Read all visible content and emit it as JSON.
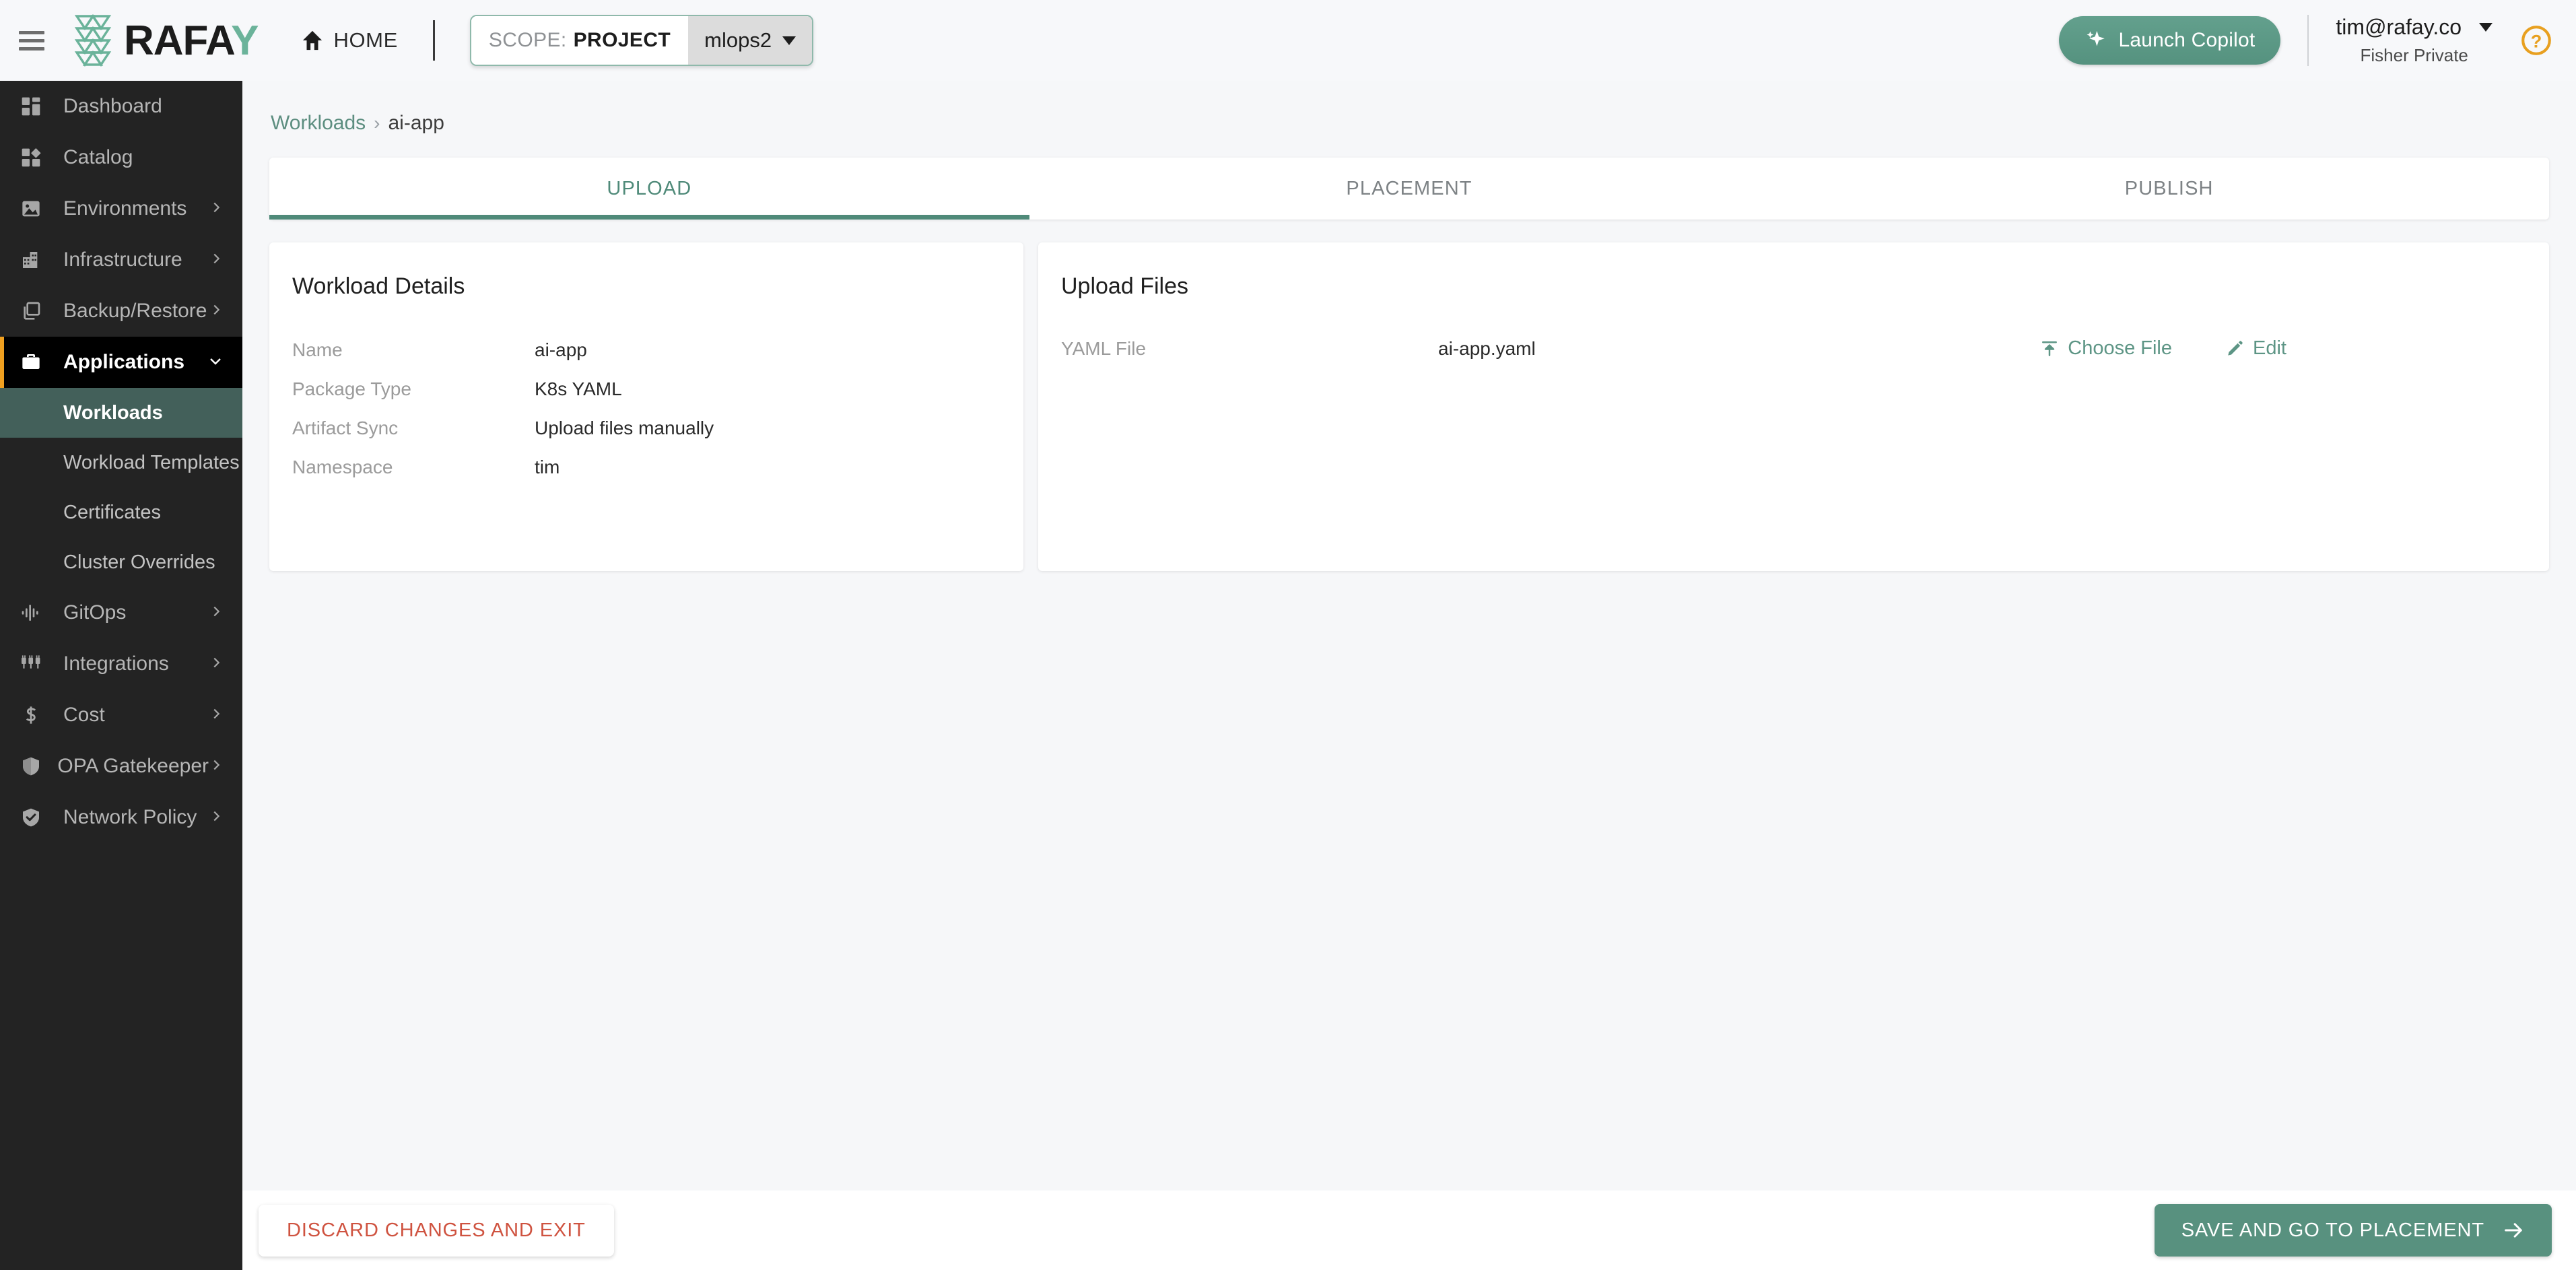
{
  "topbar": {
    "menu_icon": "hamburger-icon",
    "brand": "RAFAY",
    "brand_head": "RAFA",
    "brand_tail": "Y",
    "home_label": "HOME",
    "scope_key": "SCOPE:",
    "scope_value": "PROJECT",
    "project": "mlops2",
    "copilot_label": "Launch Copilot",
    "user_email": "tim@rafay.co",
    "user_org": "Fisher Private",
    "help_icon": "help-circle-icon"
  },
  "sidebar": {
    "items": [
      {
        "label": "Dashboard",
        "icon": "dashboard-icon",
        "expandable": false
      },
      {
        "label": "Catalog",
        "icon": "catalog-icon",
        "expandable": false
      },
      {
        "label": "Environments",
        "icon": "image-icon",
        "expandable": true
      },
      {
        "label": "Infrastructure",
        "icon": "building-icon",
        "expandable": true
      },
      {
        "label": "Backup/Restore",
        "icon": "copy-icon",
        "expandable": true
      },
      {
        "label": "Applications",
        "icon": "briefcase-icon",
        "expandable": true,
        "active": true
      },
      {
        "label": "GitOps",
        "icon": "waveform-icon",
        "expandable": true
      },
      {
        "label": "Integrations",
        "icon": "plugs-icon",
        "expandable": true
      },
      {
        "label": "Cost",
        "icon": "dollar-icon",
        "expandable": true
      },
      {
        "label": "OPA Gatekeeper",
        "icon": "shield-icon",
        "expandable": true
      },
      {
        "label": "Network Policy",
        "icon": "shield-check-icon",
        "expandable": true
      }
    ],
    "sub_items": [
      {
        "label": "Workloads",
        "selected": true
      },
      {
        "label": "Workload Templates",
        "selected": false
      },
      {
        "label": "Certificates",
        "selected": false
      },
      {
        "label": "Cluster Overrides",
        "selected": false
      }
    ]
  },
  "breadcrumb": {
    "root": "Workloads",
    "separator": "›",
    "current": "ai-app"
  },
  "tabs": [
    {
      "label": "UPLOAD",
      "active": true
    },
    {
      "label": "PLACEMENT",
      "active": false
    },
    {
      "label": "PUBLISH",
      "active": false
    }
  ],
  "workload_details": {
    "title": "Workload Details",
    "fields": [
      {
        "label": "Name",
        "value": "ai-app"
      },
      {
        "label": "Package Type",
        "value": "K8s YAML"
      },
      {
        "label": "Artifact Sync",
        "value": "Upload files manually"
      },
      {
        "label": "Namespace",
        "value": "tim"
      }
    ]
  },
  "upload_files": {
    "title": "Upload Files",
    "row_label": "YAML File",
    "row_value": "ai-app.yaml",
    "choose_file_label": "Choose File",
    "edit_label": "Edit",
    "choose_file_icon": "upload-icon",
    "edit_icon": "pencil-icon"
  },
  "footer": {
    "discard_label": "DISCARD CHANGES AND EXIT",
    "save_label": "SAVE AND GO TO PLACEMENT",
    "save_icon": "arrow-right-icon"
  },
  "colors": {
    "accent_teal": "#4f8a79",
    "sidebar_bg": "#232323",
    "active_parent_bg": "#000000",
    "active_parent_border": "#f0a020",
    "selected_sub_bg": "#43605a",
    "danger_red": "#cf5340",
    "help_orange": "#e8a020"
  }
}
